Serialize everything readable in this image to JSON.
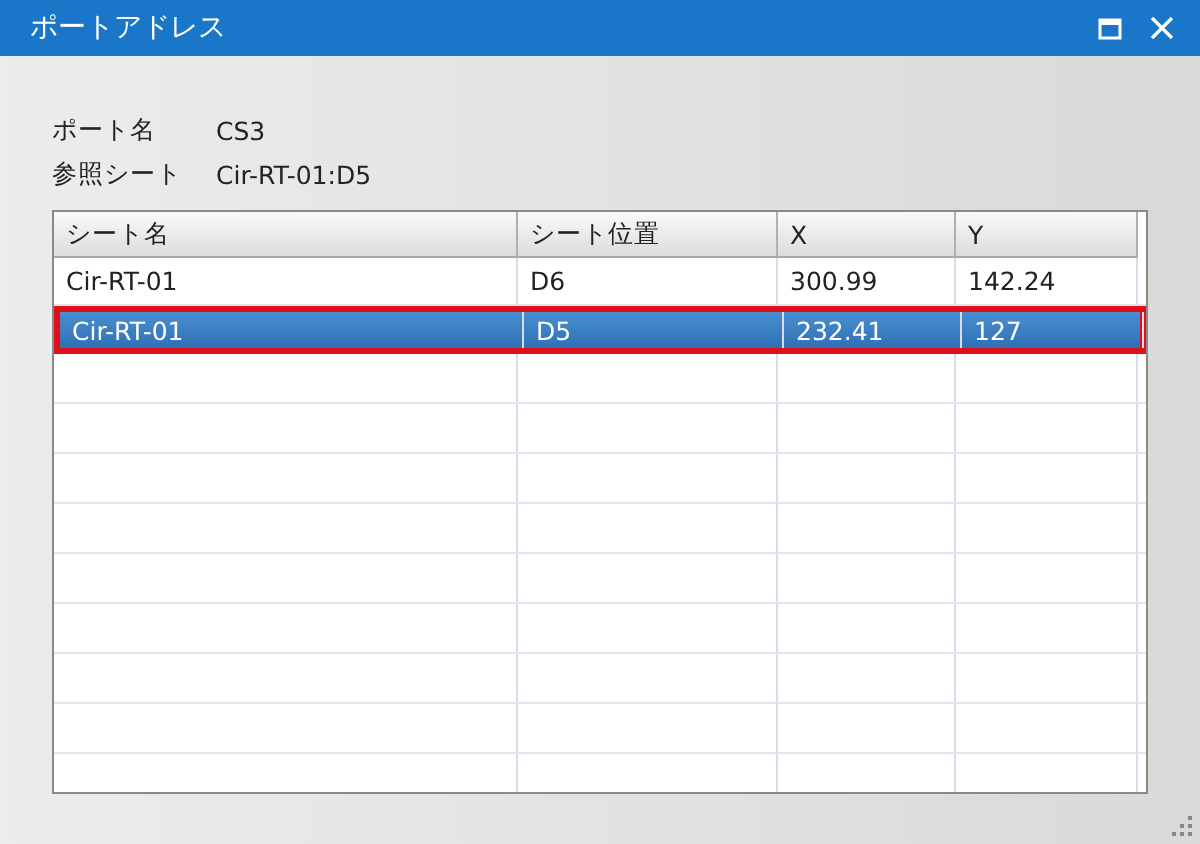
{
  "window": {
    "title": "ポートアドレス"
  },
  "fields": [
    {
      "label": "ポート名",
      "value": "CS3"
    },
    {
      "label": "参照シート",
      "value": "Cir-RT-01:D5"
    }
  ],
  "table": {
    "columns": [
      "シート名",
      "シート位置",
      "X",
      "Y"
    ],
    "rows": [
      {
        "cells": [
          "Cir-RT-01",
          "D6",
          "300.99",
          "142.24"
        ],
        "selected": false
      },
      {
        "cells": [
          "Cir-RT-01",
          "D5",
          "232.41",
          "127"
        ],
        "selected": true
      }
    ]
  }
}
